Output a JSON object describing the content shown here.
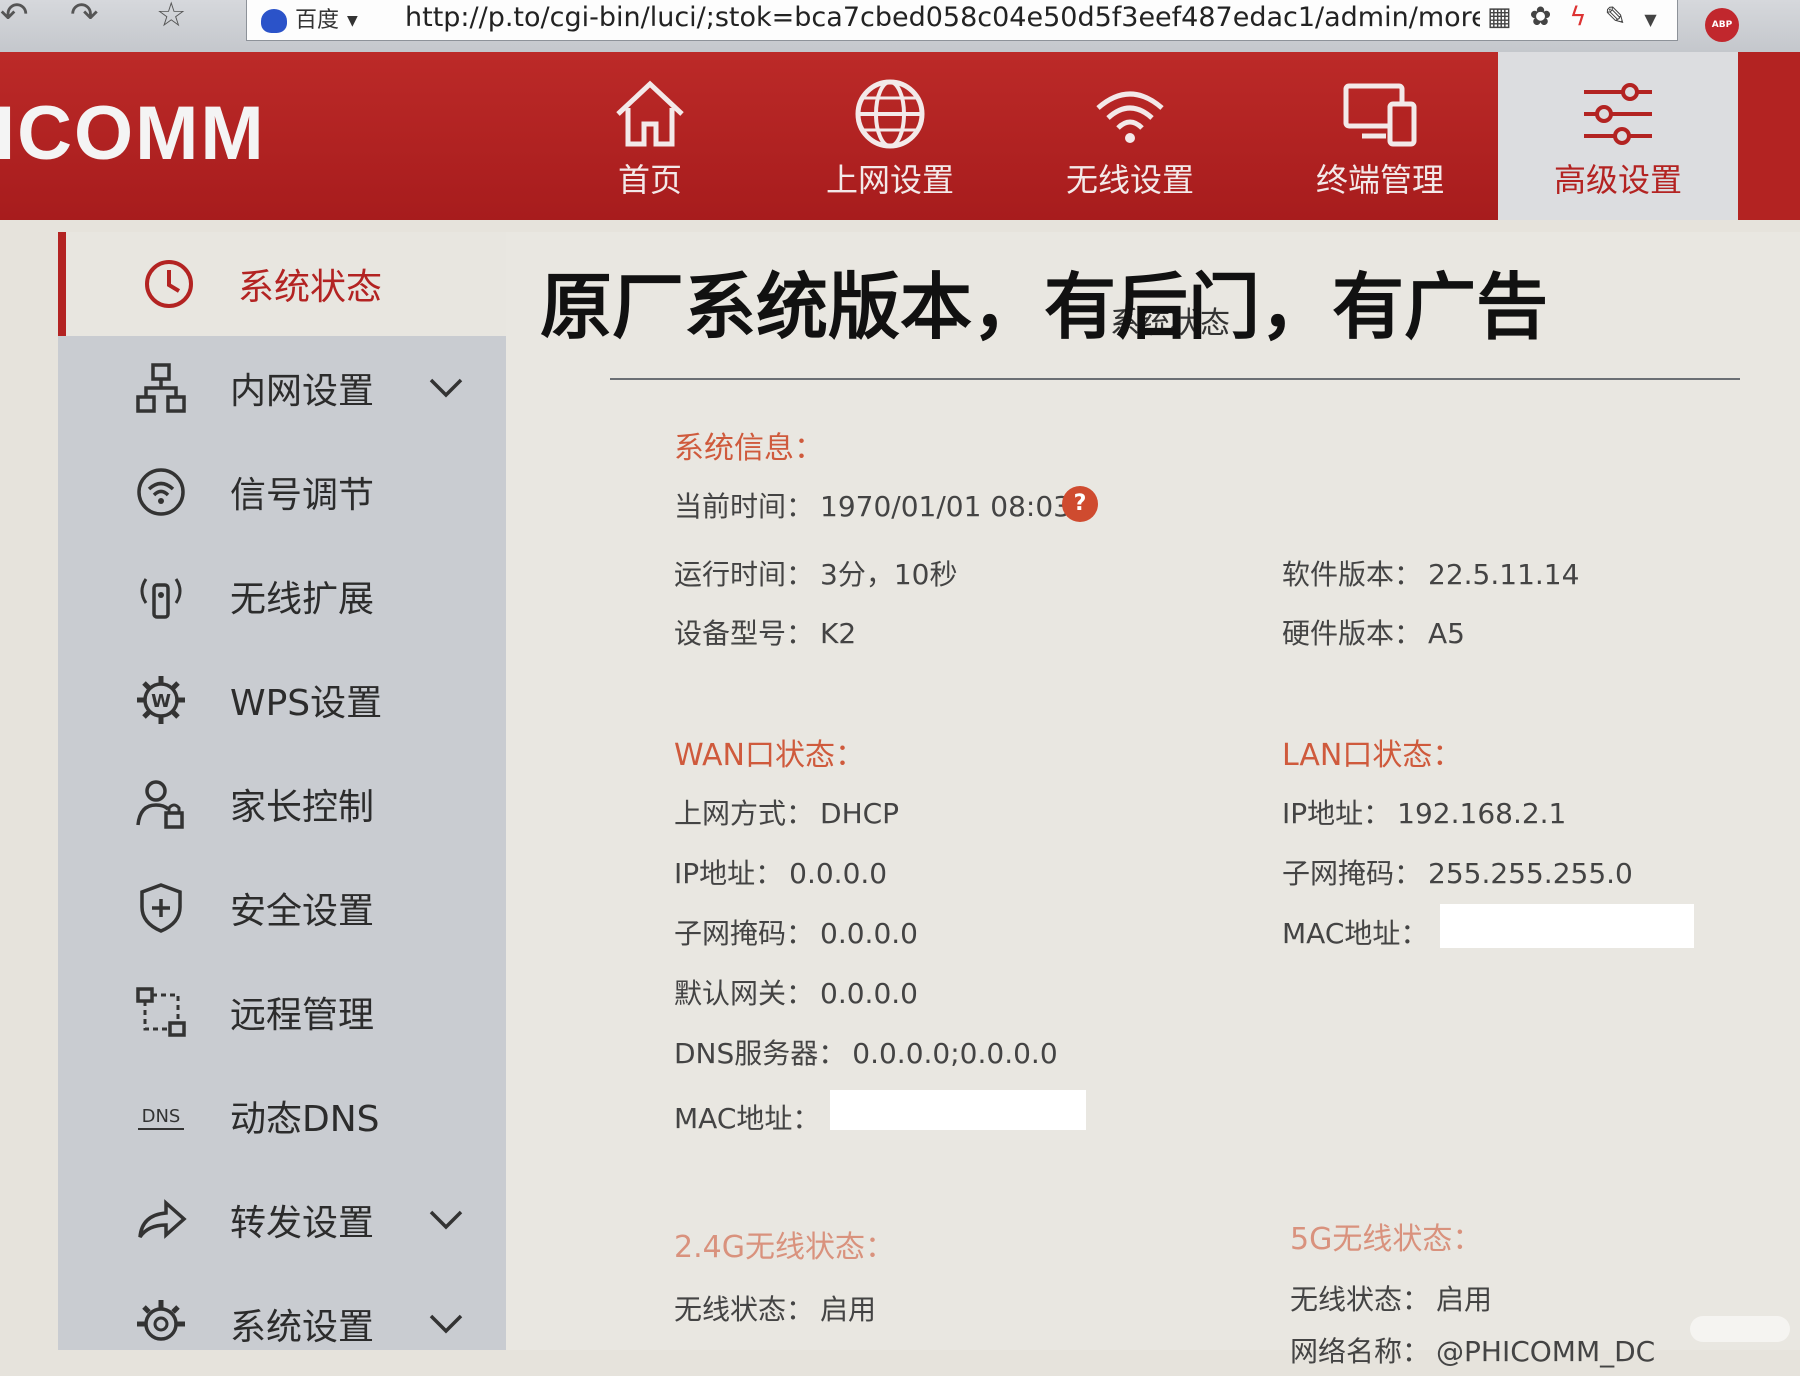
{
  "browser": {
    "search_engine": "百度",
    "url": "http://p.to/cgi-bin/luci/;stok=bca7cbed058c04e50d5f3eef487edac1/admin/more_sys",
    "abp_label": "ABP"
  },
  "header": {
    "brand": "ICOMM",
    "nav": [
      {
        "label": "首页",
        "icon": "home-icon"
      },
      {
        "label": "上网设置",
        "icon": "globe-icon"
      },
      {
        "label": "无线设置",
        "icon": "wifi-icon"
      },
      {
        "label": "终端管理",
        "icon": "devices-icon"
      },
      {
        "label": "高级设置",
        "icon": "sliders-icon",
        "active": true
      }
    ]
  },
  "sidebar": {
    "items": [
      {
        "label": "系统状态",
        "icon": "clock-icon",
        "active": true
      },
      {
        "label": "内网设置",
        "icon": "network-icon",
        "expandable": true
      },
      {
        "label": "信号调节",
        "icon": "signal-icon"
      },
      {
        "label": "无线扩展",
        "icon": "antenna-icon"
      },
      {
        "label": "WPS设置",
        "icon": "wps-gear-icon"
      },
      {
        "label": "家长控制",
        "icon": "user-lock-icon"
      },
      {
        "label": "安全设置",
        "icon": "shield-icon"
      },
      {
        "label": "远程管理",
        "icon": "remote-icon"
      },
      {
        "label": "动态DNS",
        "icon": "dns-icon"
      },
      {
        "label": "转发设置",
        "icon": "forward-icon",
        "expandable": true
      },
      {
        "label": "系统设置",
        "icon": "gear-icon",
        "expandable": true
      }
    ]
  },
  "overlay_caption": "原厂系统版本，有后门，有广告",
  "main": {
    "page_title": "系统状态",
    "system_info": {
      "title": "系统信息：",
      "current_time_label": "当前时间：",
      "current_time": "1970/01/01 08:03",
      "uptime_label": "运行时间：",
      "uptime": "3分，10秒",
      "model_label": "设备型号：",
      "model": "K2",
      "software_label": "软件版本：",
      "software": "22.5.11.14",
      "hardware_label": "硬件版本：",
      "hardware": "A5"
    },
    "wan": {
      "title": "WAN口状态：",
      "mode_label": "上网方式：",
      "mode": "DHCP",
      "ip_label": "IP地址：",
      "ip": "0.0.0.0",
      "mask_label": "子网掩码：",
      "mask": "0.0.0.0",
      "gateway_label": "默认网关：",
      "gateway": "0.0.0.0",
      "dns_label": "DNS服务器：",
      "dns": "0.0.0.0;0.0.0.0",
      "mac_label": "MAC地址："
    },
    "lan": {
      "title": "LAN口状态：",
      "ip_label": "IP地址：",
      "ip": "192.168.2.1",
      "mask_label": "子网掩码：",
      "mask": "255.255.255.0",
      "mac_label": "MAC地址："
    },
    "wifi24": {
      "title": "2.4G无线状态：",
      "state_label": "无线状态：",
      "state": "启用"
    },
    "wifi5": {
      "title": "5G无线状态：",
      "state_label": "无线状态：",
      "state": "启用",
      "ssid_label": "网络名称：",
      "ssid": "@PHICOMM_DC"
    }
  }
}
